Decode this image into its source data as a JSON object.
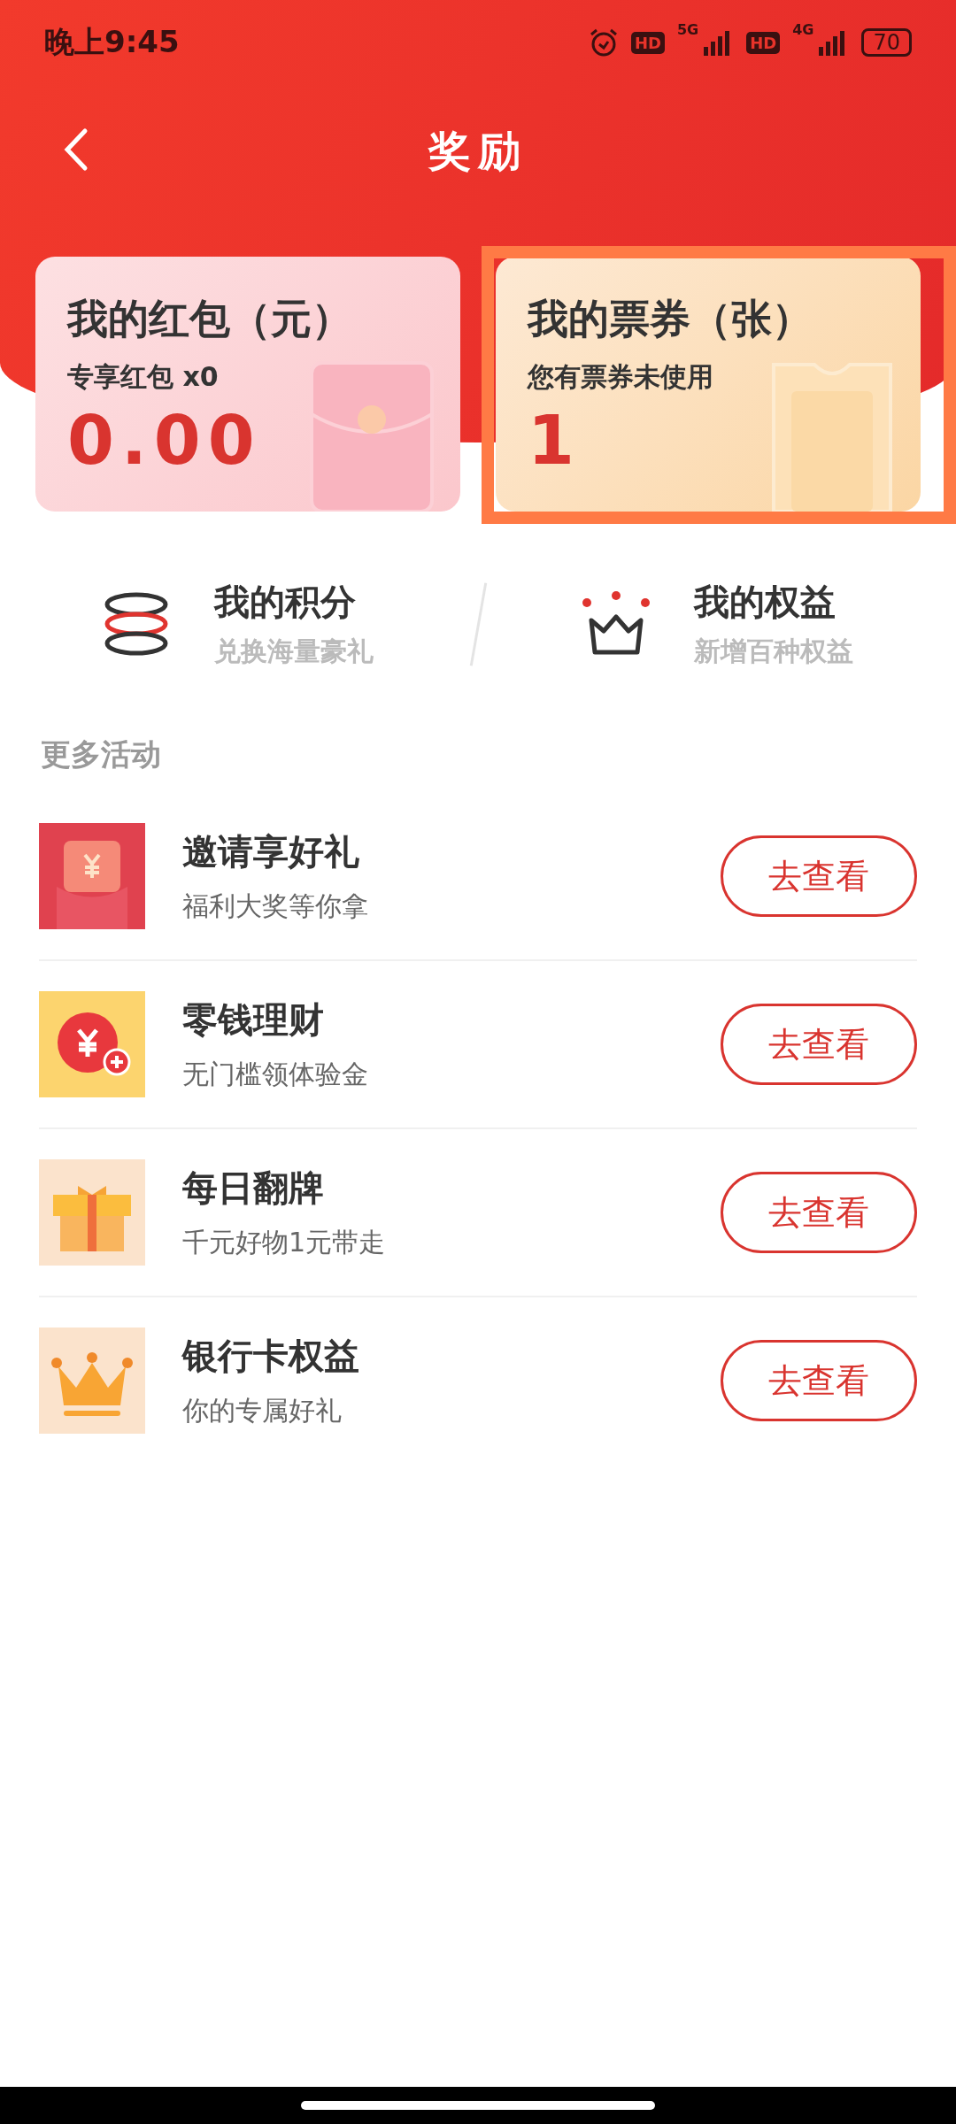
{
  "status_bar": {
    "time": "晚上9:45",
    "hd_1": "HD",
    "network_1": "5G",
    "hd_2": "HD",
    "network_2": "4G",
    "battery": "70"
  },
  "header": {
    "title": "奖励"
  },
  "cards": [
    {
      "kind": "envelope",
      "title": "我的红包（元）",
      "subtitle": "专享红包 x0",
      "value": "0.00",
      "highlighted": false
    },
    {
      "kind": "ticket",
      "title": "我的票券（张）",
      "subtitle": "您有票券未使用",
      "value": "1",
      "highlighted": true
    }
  ],
  "shortcuts": [
    {
      "kind": "coins",
      "title": "我的积分",
      "subtitle": "兑换海量豪礼"
    },
    {
      "kind": "crown",
      "title": "我的权益",
      "subtitle": "新增百种权益"
    }
  ],
  "section_title": "更多活动",
  "activities": [
    {
      "kind": "envelope",
      "title": "邀请享好礼",
      "subtitle": "福利大奖等你拿",
      "button": "去查看"
    },
    {
      "kind": "coin",
      "title": "零钱理财",
      "subtitle": "无门槛领体验金",
      "button": "去查看"
    },
    {
      "kind": "gift",
      "title": "每日翻牌",
      "subtitle": "千元好物1元带走",
      "button": "去查看"
    },
    {
      "kind": "crown",
      "title": "银行卡权益",
      "subtitle": "你的专属好礼",
      "button": "去查看"
    }
  ]
}
